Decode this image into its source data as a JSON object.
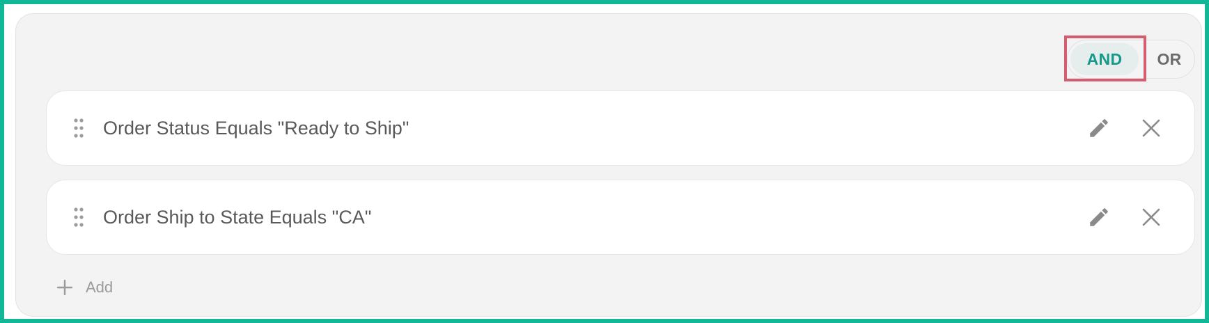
{
  "logic_toggle": {
    "options": [
      "AND",
      "OR"
    ],
    "selected": "AND"
  },
  "rules": [
    {
      "text": "Order Status Equals \"Ready to Ship\""
    },
    {
      "text": "Order Ship to State Equals \"CA\""
    }
  ],
  "actions": {
    "add_label": "Add"
  },
  "icons": {
    "drag": "drag-handle-icon",
    "edit": "pencil-icon",
    "delete": "close-icon",
    "add": "plus-icon"
  },
  "colors": {
    "frame": "#12b795",
    "accent": "#15998a",
    "highlight": "#d45e6f"
  }
}
